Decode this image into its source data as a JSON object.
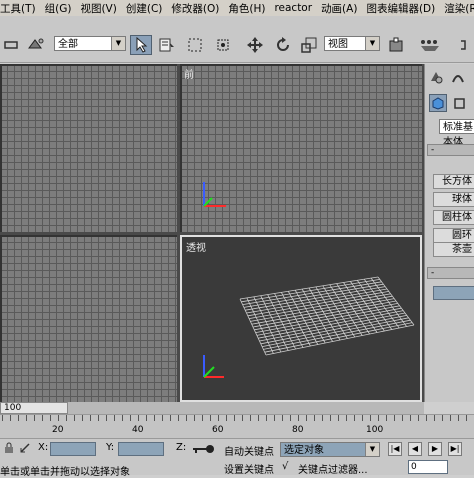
{
  "menu": {
    "items": [
      "工具(T)",
      "组(G)",
      "视图(V)",
      "创建(C)",
      "修改器(O)",
      "角色(H)",
      "reactor",
      "动画(A)",
      "图表编辑器(D)",
      "渲染(R)"
    ]
  },
  "toolbar": {
    "selection_filter": "全部",
    "reference_coord": "视图"
  },
  "viewports": {
    "perspective_label": "透视",
    "left_label": "前"
  },
  "command_panel": {
    "category": "标准基本体",
    "rollout_object_type": "-",
    "buttons": [
      "长方体",
      "球体",
      "圆柱体",
      "圆环",
      "茶壶"
    ],
    "rollout_name_color": "-"
  },
  "timeline": {
    "slider_text": "100",
    "ticks": [
      "20",
      "40",
      "60",
      "80",
      "100"
    ]
  },
  "statusbar": {
    "x_label": "X:",
    "y_label": "Y:",
    "z_label": "Z:",
    "auto_key": "自动关键点",
    "selected_object": "选定对象",
    "set_key": "设置关键点",
    "key_filters": "关键点过滤器...",
    "prompt": "单击或单击并拖动以选择对象",
    "frame_value": "0"
  },
  "colors": {
    "viewport_bg": "#7d7d7d",
    "perspective_bg": "#3a3a3a",
    "field_blue": "#8da4b8",
    "axis_x": "#ff2a2a",
    "axis_y": "#22dd22",
    "axis_z": "#3a5bff"
  }
}
